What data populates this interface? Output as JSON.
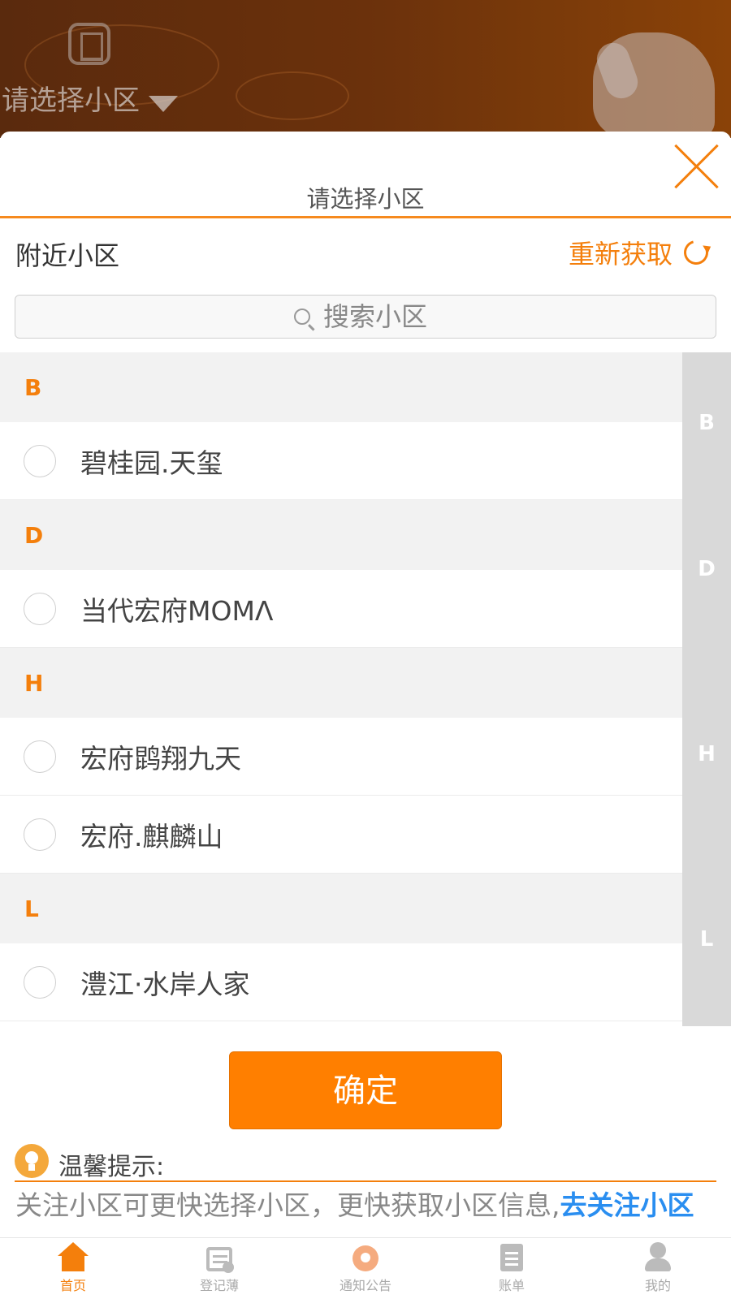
{
  "background": {
    "header_title": "请选择小区"
  },
  "modal": {
    "title": "请选择小区",
    "nearby_label": "附近小区",
    "refresh_label": "重新获取",
    "search": {
      "placeholder": "搜索小区"
    },
    "groups": [
      {
        "letter": "B",
        "items": [
          {
            "name": "碧桂园.天玺",
            "selected": false
          }
        ]
      },
      {
        "letter": "D",
        "items": [
          {
            "name": "当代宏府MOMΛ",
            "selected": false
          }
        ]
      },
      {
        "letter": "H",
        "items": [
          {
            "name": "宏府鹍翔九天",
            "selected": false
          },
          {
            "name": "宏府.麒麟山",
            "selected": false
          }
        ]
      },
      {
        "letter": "L",
        "items": [
          {
            "name": "澧江·水岸人家",
            "selected": false
          }
        ]
      }
    ],
    "index_letters": [
      "B",
      "D",
      "H",
      "L"
    ],
    "confirm_label": "确定",
    "tip": {
      "title": "温馨提示:",
      "text": "关注小区可更快选择小区，更快获取小区信息,",
      "link": "去关注小区"
    }
  },
  "tabbar": {
    "items": [
      {
        "label": "首页",
        "icon": "home-icon",
        "active": true
      },
      {
        "label": "登记薄",
        "icon": "calendar-icon",
        "active": false
      },
      {
        "label": "通知公告",
        "icon": "notice-icon",
        "active": false
      },
      {
        "label": "账单",
        "icon": "bill-icon",
        "active": false
      },
      {
        "label": "我的",
        "icon": "user-icon",
        "active": false
      }
    ]
  },
  "colors": {
    "accent": "#f47f0c",
    "confirm": "#ff7f00",
    "link": "#2a8ef0"
  }
}
